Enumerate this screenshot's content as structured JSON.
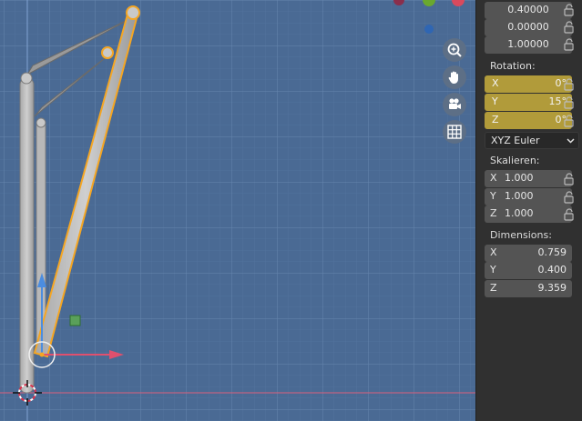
{
  "location": {
    "values": [
      "0.40000",
      "0.00000",
      "1.00000"
    ]
  },
  "rotation": {
    "label": "Rotation:",
    "fields": [
      {
        "axis": "X",
        "value": "0°"
      },
      {
        "axis": "Y",
        "value": "15°"
      },
      {
        "axis": "Z",
        "value": "0°"
      }
    ],
    "mode": "XYZ Euler"
  },
  "scale": {
    "label": "Skalieren:",
    "fields": [
      {
        "axis": "X",
        "value": "1.000"
      },
      {
        "axis": "Y",
        "value": "1.000"
      },
      {
        "axis": "Z",
        "value": "1.000"
      }
    ]
  },
  "dimensions": {
    "label": "Dimensions:",
    "fields": [
      {
        "axis": "X",
        "value": "0.759"
      },
      {
        "axis": "Y",
        "value": "0.400"
      },
      {
        "axis": "Z",
        "value": "9.359"
      }
    ]
  },
  "icons": {
    "zoom": "zoom-icon",
    "pan": "hand-pan-icon",
    "camera": "camera-icon",
    "ortho": "grid-ortho-icon",
    "lock": "lock-icon",
    "cursor": "3d-cursor-icon"
  },
  "colors": {
    "viewport": "#4a6a94",
    "selection": "#f5a623",
    "rotation_keyed": "#b19b3a",
    "x_axis": "#e0506e",
    "y_axis_gizmo": "#4b8de0"
  }
}
